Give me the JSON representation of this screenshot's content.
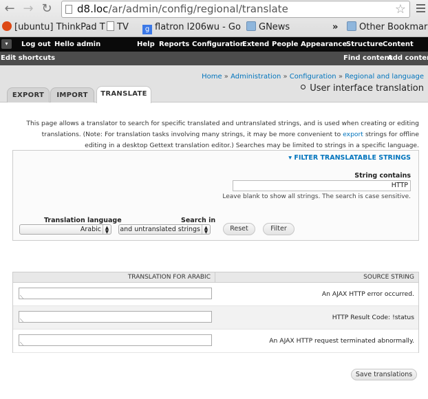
{
  "browser": {
    "url_host": "d8.loc",
    "url_path": "/ar/admin/config/regional/translate",
    "bookmarks": [
      {
        "label": "[ubuntu] ThinkPad T",
        "icon": "ubuntu-icon"
      },
      {
        "label": "TV",
        "icon": "page-icon"
      },
      {
        "label": "flatron l206wu - Go",
        "icon": "google-icon"
      },
      {
        "label": "GNews",
        "icon": "folder-icon"
      },
      {
        "label": "»",
        "icon": "chevron-icon"
      },
      {
        "label": "Other Bookmarks",
        "icon": "folder-icon"
      }
    ]
  },
  "toolbar": {
    "logout": "Log out",
    "hello": "Hello admin",
    "menu": [
      "Help",
      "Reports",
      "Configuration",
      "Extend",
      "People",
      "Appearance",
      "Structure",
      "Content"
    ],
    "edit_shortcuts": "Edit shortcuts",
    "shortcut_links": [
      "Find content",
      "Add content"
    ]
  },
  "breadcrumb": [
    "Home",
    "Administration",
    "Configuration",
    "Regional and language"
  ],
  "breadcrumb_sep": "»",
  "page_title": "User interface translation",
  "tabs": [
    {
      "label": "EXPORT",
      "active": false
    },
    {
      "label": "IMPORT",
      "active": false
    },
    {
      "label": "TRANSLATE",
      "active": true
    }
  ],
  "description": {
    "before": "This page allows a translator to search for specific translated and untranslated strings, and is used when creating or editing translations. (Note: For translation tasks involving many strings, it may be more convenient to",
    "link": "export",
    "after": "strings for offline editing in a desktop Gettext translation editor.) Searches may be limited to strings in a specific language."
  },
  "filter": {
    "legend": "FILTER TRANSLATABLE STRINGS",
    "contains_label": "String contains",
    "contains_value": "HTTP",
    "contains_help": "Leave blank to show all strings. The search is case sensitive.",
    "language_label": "Translation language",
    "language_value": "Arabic",
    "search_label": "Search in",
    "search_value": "Both translated and untranslated strings",
    "reset": "Reset",
    "filter": "Filter"
  },
  "table": {
    "headers": {
      "translation": "TRANSLATION FOR ARABIC",
      "source": "SOURCE STRING"
    },
    "rows": [
      {
        "source": "An AJAX HTTP error occurred.",
        "translation": ""
      },
      {
        "source": "HTTP Result Code: !status",
        "translation": ""
      },
      {
        "source": "An AJAX HTTP request terminated abnormally.",
        "translation": ""
      }
    ]
  },
  "save_button": "Save translations"
}
